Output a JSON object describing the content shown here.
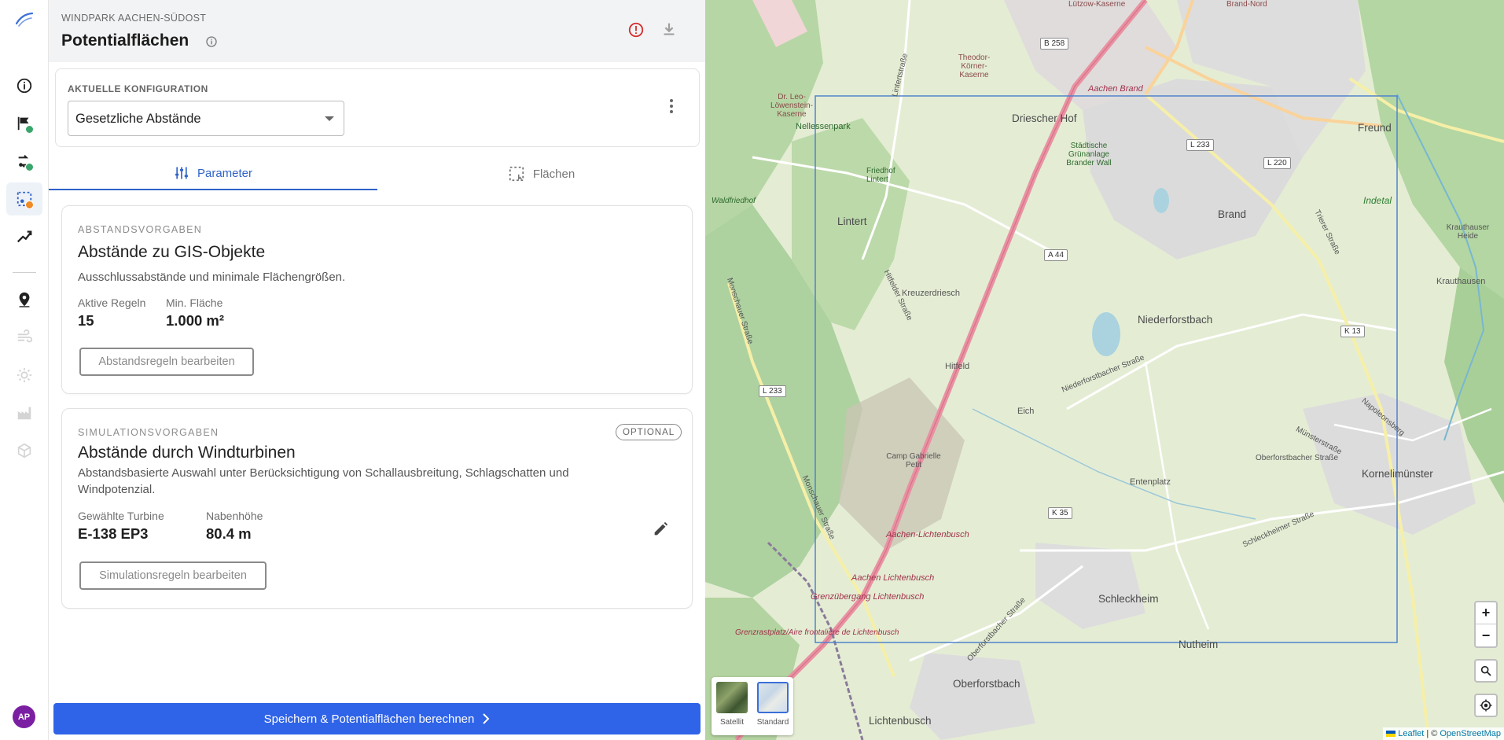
{
  "header": {
    "project": "WINDPARK AACHEN-SÜDOST",
    "title": "Potentialflächen"
  },
  "config": {
    "label": "AKTUELLE KONFIGURATION",
    "selected": "Gesetzliche Abstände"
  },
  "tabs": [
    {
      "label": "Parameter",
      "active": true
    },
    {
      "label": "Flächen",
      "active": false
    }
  ],
  "card1": {
    "overline": "ABSTANDSVORGABEN",
    "title": "Abstände zu GIS-Objekte",
    "description": "Ausschlussabstände und minimale Flächengrößen.",
    "stats": [
      {
        "label": "Aktive Regeln",
        "value": "15"
      },
      {
        "label": "Min. Fläche",
        "value": "1.000 m²"
      }
    ],
    "button": "Abstandsregeln bearbeiten"
  },
  "card2": {
    "overline": "SIMULATIONSVORGABEN",
    "chip": "OPTIONAL",
    "title": "Abstände durch Windturbinen",
    "description": "Abstandsbasierte Auswahl unter Berücksichtigung von Schallausbreitung, Schlagschatten und Windpotenzial.",
    "stats": [
      {
        "label": "Gewählte Turbine",
        "value": "E-138 EP3"
      },
      {
        "label": "Nabenhöhe",
        "value": "80.4 m"
      }
    ],
    "button": "Simulationsregeln bearbeiten"
  },
  "primary_button": "Speichern & Potentialflächen berechnen",
  "user": {
    "initials": "AP"
  },
  "map": {
    "labels": {
      "drieschers_hof": "Driescher Hof",
      "lintert": "Lintert",
      "brand": "Brand",
      "niederforstbach": "Niederforstbach",
      "kreuzerdriesch": "Kreuzerdriesch",
      "hitfeld": "Hitfeld",
      "eich": "Eich",
      "entenplatz": "Entenplatz",
      "schleckheim": "Schleckheim",
      "nutheim": "Nutheim",
      "oberforstbach": "Oberforstbach",
      "lichtenbusch": "Lichtenbusch",
      "kornelimuenster": "Kornelimünster",
      "freund": "Freund",
      "indetal": "Indetal",
      "krauthausen": "Krauthausen",
      "krauthauser_heide": "Krauthauser Heide",
      "waldfriedhof": "Waldfriedhof",
      "nellessenpark": "Nellessenpark",
      "friedhof_lintert": "Friedhof Lintert",
      "camp_gabrielle": "Camp Gabrielle Petit",
      "aachen_brand": "Aachen Brand",
      "aachen_lichtenbusch1": "Aachen-Lichtenbusch",
      "aachen_lichtenbusch2": "Aachen Lichtenbusch",
      "grenzuebergang": "Grenzübergang Lichtenbusch",
      "grenzrastplatz": "Grenzrastplatz/Aire frontalière de Lichtenbusch",
      "niederforstbacher_str": "Niederforstbacher Straße",
      "monschauer_str": "Monschauer Straße",
      "oberforstbacher_str": "Oberforstbacher Straße",
      "schleckheimer_str": "Schleckheimer Straße",
      "trierer_str": "Trierer Straße",
      "muensterstr": "Münsterstraße",
      "napoleonsberg": "Napoleonsberg",
      "lintertstr": "Lintertstraße",
      "hitfelder_str": "Hitfelder Straße",
      "theodor_koerner": "Theodor-Körner-Kaserne",
      "dr_leo": "Dr. Leo-Löwenstein-Kaserne",
      "staedtische": "Städtische Grünanlage Brander Wall",
      "lutzow": "Lützow-Kaserne",
      "brand_nord": "Brand-Nord"
    },
    "shields": {
      "a44": "A 44",
      "b258": "B 258",
      "l233a": "L 233",
      "l233b": "L 233",
      "l220": "L 220",
      "k13": "K 13",
      "k35": "K 35"
    },
    "layers": [
      {
        "label": "Satellit",
        "active": false
      },
      {
        "label": "Standard",
        "active": true
      }
    ],
    "attribution_leaflet": "Leaflet",
    "attribution_sep": "| ©",
    "attribution_osm": "OpenStreetMap",
    "zoom_in": "+",
    "zoom_out": "−",
    "colors": {
      "selection": "#4f83cc",
      "motorway": "#e892a2",
      "forest": "#aed1a0",
      "urban": "#dcdcdc"
    }
  }
}
